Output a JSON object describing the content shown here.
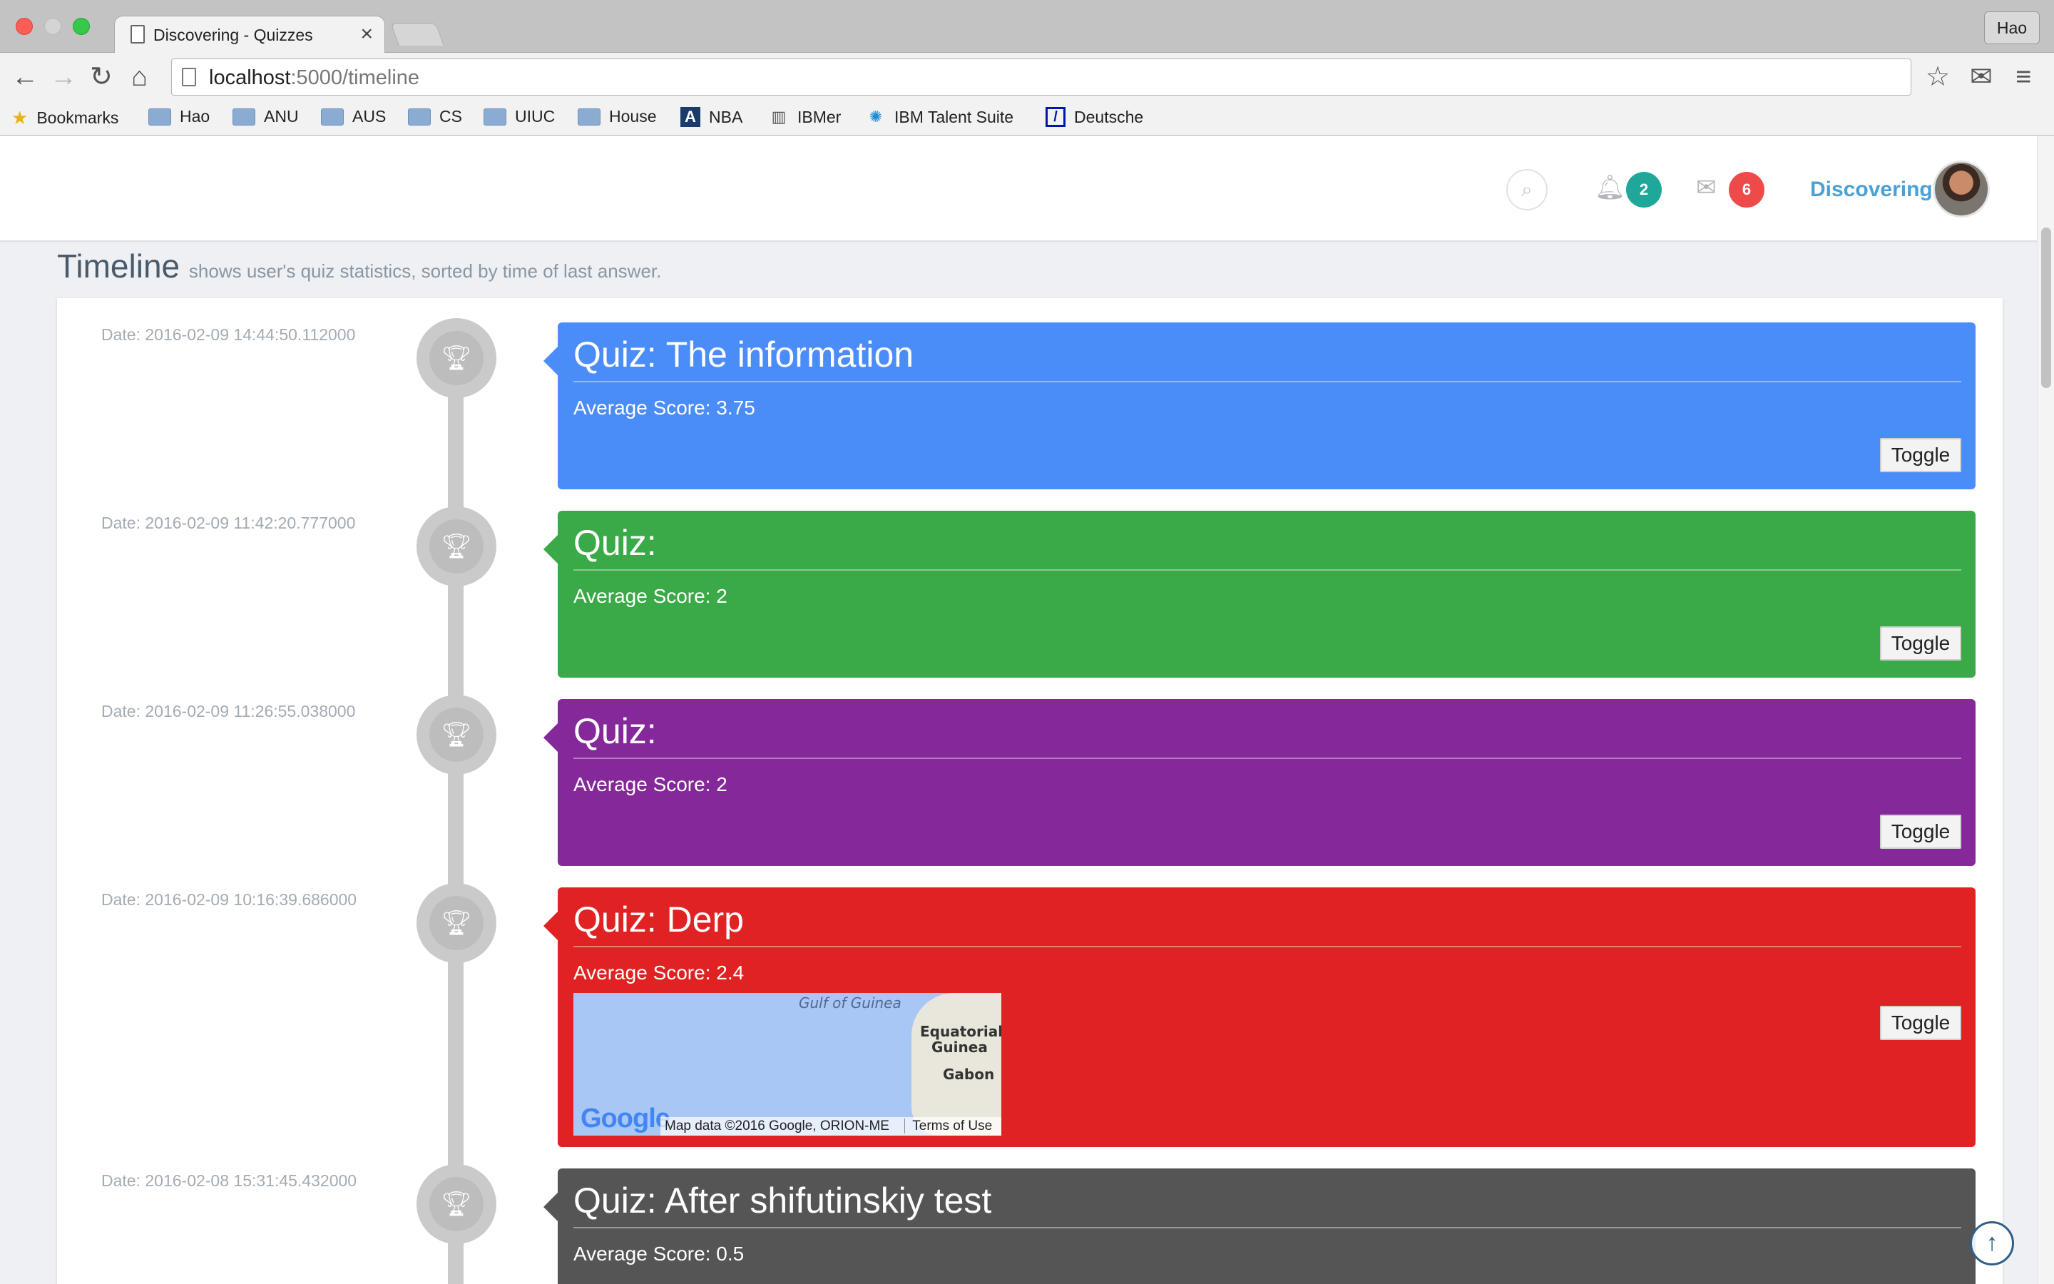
{
  "browser": {
    "tab_title": "Discovering - Quizzes",
    "tab_close": "×",
    "profile": "Hao",
    "url_host": "localhost",
    "url_path": ":5000/timeline",
    "bookmarks": [
      "Bookmarks",
      "Hao",
      "ANU",
      "AUS",
      "CS",
      "UIUC",
      "House",
      "NBA",
      "IBMer",
      "IBM Talent Suite",
      "Deutsche"
    ]
  },
  "header": {
    "notifications_count": "2",
    "messages_count": "6",
    "user_name": "Discovering"
  },
  "page": {
    "title": "Timeline",
    "subtitle": "shows user's quiz statistics, sorted by time of last answer."
  },
  "timeline": [
    {
      "date": "Date: 2016-02-09 14:44:50.112000",
      "title": "Quiz: The information",
      "score": "Average Score: 3.75",
      "toggle": "Toggle",
      "color": "#4b8df8"
    },
    {
      "date": "Date: 2016-02-09 11:42:20.777000",
      "title": "Quiz:",
      "score": "Average Score: 2",
      "toggle": "Toggle",
      "color": "#39aa47"
    },
    {
      "date": "Date: 2016-02-09 11:26:55.038000",
      "title": "Quiz:",
      "score": "Average Score: 2",
      "toggle": "Toggle",
      "color": "#852899"
    },
    {
      "date": "Date: 2016-02-09 10:16:39.686000",
      "title": "Quiz: Derp",
      "score": "Average Score: 2.4",
      "toggle": "Toggle",
      "color": "#e02222"
    },
    {
      "date": "Date: 2016-02-08 15:31:45.432000",
      "title": "Quiz: After shifutinskiy test",
      "score": "Average Score: 0.5",
      "color": "#555555"
    }
  ],
  "map": {
    "label_gulf": "Gulf of Guinea",
    "label_eq_1": "Equatorial",
    "label_eq_2": "Guinea",
    "label_gabon": "Gabon",
    "logo": "Google",
    "attribution": "Map data ©2016 Google, ORION-ME",
    "terms": "Terms of Use"
  },
  "icons": {
    "trophy": "trophy-icon",
    "bell": "bell-icon",
    "mail": "envelope-icon",
    "search": "search-icon",
    "scroll_top": "arrow-up-circle-icon"
  }
}
